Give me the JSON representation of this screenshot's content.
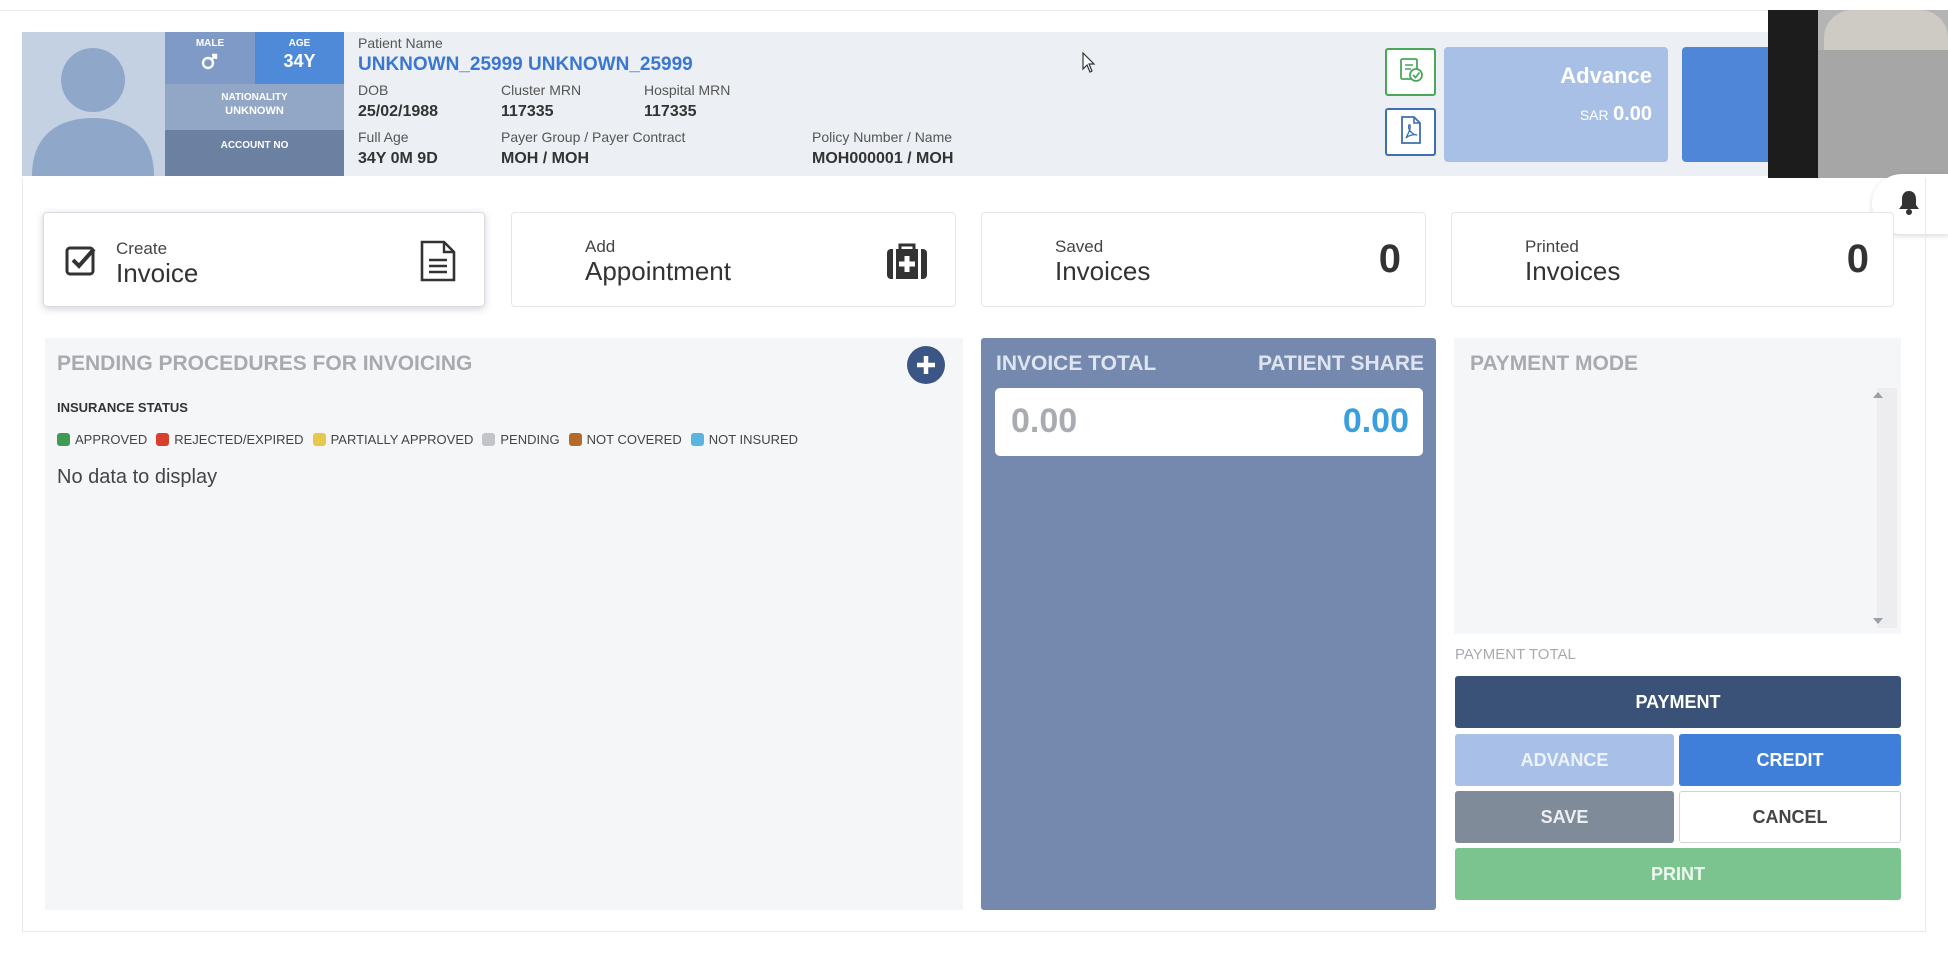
{
  "patient": {
    "gender_label": "MALE",
    "age_label": "AGE",
    "age_value": "34Y",
    "nationality_label": "NATIONALITY",
    "nationality_value": "UNKNOWN",
    "account_label": "ACCOUNT NO",
    "name_label": "Patient Name",
    "name_value": "UNKNOWN_25999 UNKNOWN_25999",
    "dob_label": "DOB",
    "dob_value": "25/02/1988",
    "cluster_mrn_label": "Cluster MRN",
    "cluster_mrn_value": "117335",
    "hospital_mrn_label": "Hospital MRN",
    "hospital_mrn_value": "117335",
    "full_age_label": "Full Age",
    "full_age_value": "34Y 0M 9D",
    "payer_label": "Payer Group / Payer Contract",
    "payer_value": "MOH / MOH",
    "policy_label": "Policy Number / Name",
    "policy_value": "MOH000001 / MOH",
    "gender_icon": "male-icon",
    "avatar_icon": "user-silhouette-icon"
  },
  "advance": {
    "title": "Advance",
    "currency": "SAR",
    "amount": "0.00"
  },
  "cards": {
    "create": {
      "small": "Create",
      "big": "Invoice",
      "icon": "document-icon",
      "check_icon": "checkbox-checked-icon"
    },
    "appointment": {
      "small": "Add",
      "big": "Appointment",
      "icon": "medical-kit-icon"
    },
    "saved": {
      "small": "Saved",
      "big": "Invoices",
      "count": "0"
    },
    "printed": {
      "small": "Printed",
      "big": "Invoices",
      "count": "0"
    }
  },
  "pending": {
    "title": "PENDING PROCEDURES FOR INVOICING",
    "insurance_status": "INSURANCE STATUS",
    "legend": [
      {
        "label": "APPROVED",
        "color": "#3f9a54"
      },
      {
        "label": "REJECTED/EXPIRED",
        "color": "#d9402b"
      },
      {
        "label": "PARTIALLY APPROVED",
        "color": "#e8c84a"
      },
      {
        "label": "PENDING",
        "color": "#c2c4c7"
      },
      {
        "label": "NOT COVERED",
        "color": "#b56a2c"
      },
      {
        "label": "NOT INSURED",
        "color": "#5ab4e0"
      }
    ],
    "empty": "No data to display"
  },
  "invoice": {
    "total_label": "INVOICE TOTAL",
    "share_label": "PATIENT SHARE",
    "total_value": "0.00",
    "share_value": "0.00"
  },
  "payment": {
    "mode_label": "PAYMENT MODE",
    "total_label": "PAYMENT TOTAL",
    "payment_btn": "PAYMENT",
    "advance_btn": "ADVANCE",
    "credit_btn": "CREDIT",
    "save_btn": "SAVE",
    "cancel_btn": "CANCEL",
    "print_btn": "PRINT"
  },
  "colors": {
    "accent_blue": "#3f7fd9",
    "dark_navy": "#3a5178",
    "panel_slate": "#7489ad",
    "print_green": "#7cc48f"
  }
}
